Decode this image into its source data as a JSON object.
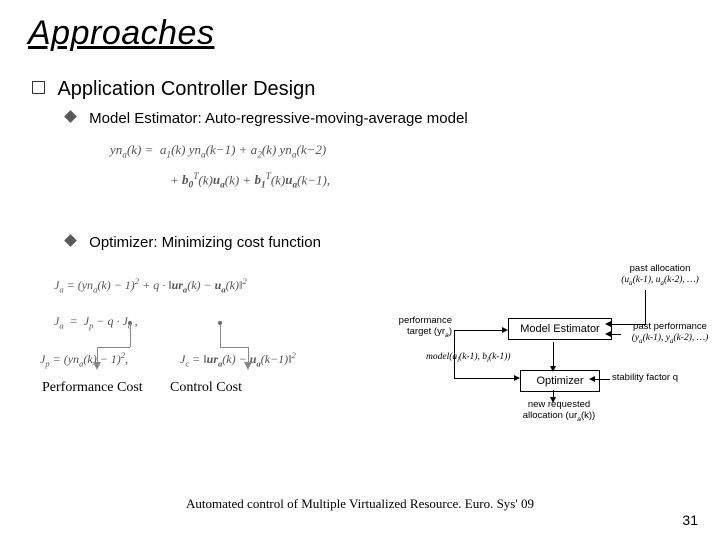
{
  "title": "Approaches",
  "section": "Application Controller Design",
  "sub1": "Model Estimator:  Auto-regressive-moving-average model",
  "sub2": "Optimizer: Minimizing cost function",
  "eq1": "yn_a(k) = a_1(k) yn_a(k−1) + a_2(k) yn_a(k−2)",
  "eq2": "+ b_0^T(k) u_a(k) + b_1^T(k) u_a(k−1),",
  "eq3": "J_a = (yn_a(k) − 1)^2 + q · ‖ur_a(k) − u_a(k)‖^2",
  "eq4": "J_a  =  J_p − q · J_c ,",
  "eq5a": "J_p = (yn_a(k) − 1)^2,",
  "eq5b": "J_c = ‖ur_a(k) − u_a(k−1)‖^2",
  "cost1": "Performance Cost",
  "cost2": "Control Cost",
  "diagram": {
    "box1": "Model Estimator",
    "box2": "Optimizer",
    "past_alloc_label": "past allocation",
    "past_alloc_expr": "(u_a(k-1), u_a(k-2), …)",
    "past_perf_label": "past performance",
    "past_perf_expr": "(y_a(k-1), y_a(k-2), …)",
    "target_label": "performance target (yr_a)",
    "stability_label": "stability factor q",
    "model_label": "model(a_i(k-1), b_i(k-1))",
    "output_label": "new requested allocation (ur_a(k))"
  },
  "footer": "Automated control of Multiple Virtualized Resource. Euro. Sys' 09",
  "page": "31"
}
